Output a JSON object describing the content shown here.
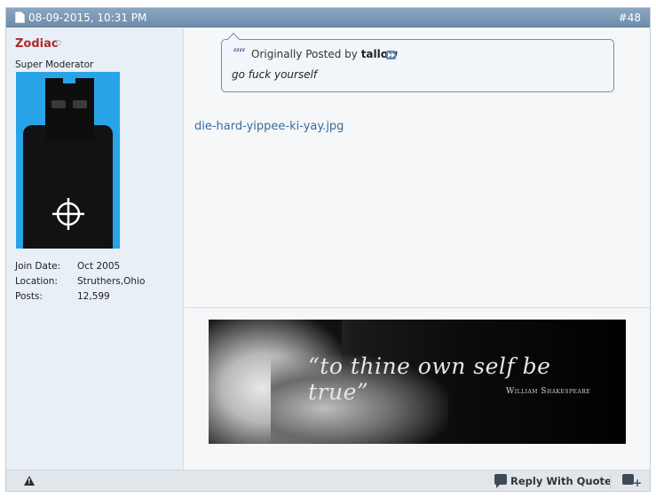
{
  "post": {
    "date": "08-09-2015, 10:31 PM",
    "number": "#48"
  },
  "user": {
    "name": "Zodiac",
    "title": "Super Moderator",
    "stats": [
      {
        "label": "Join Date:",
        "value": "Oct 2005"
      },
      {
        "label": "Location:",
        "value": "Struthers,Ohio"
      },
      {
        "label": "Posts:",
        "value": "12,599"
      }
    ]
  },
  "quote": {
    "prefix": "Originally Posted by",
    "author": "tallow",
    "text": "go fuck yourself"
  },
  "attachment": {
    "filename": "die-hard-yippee-ki-yay.jpg"
  },
  "signature": {
    "quote": "“to thine own self be true”",
    "author": "William Shakespeare"
  },
  "footer": {
    "reply_with_quote": "Reply With Quote"
  },
  "colors": {
    "header_bg": "#7b98b5",
    "username": "#b02b2b",
    "link": "#3b6b9c",
    "avatar_bg": "#29a3e8"
  }
}
